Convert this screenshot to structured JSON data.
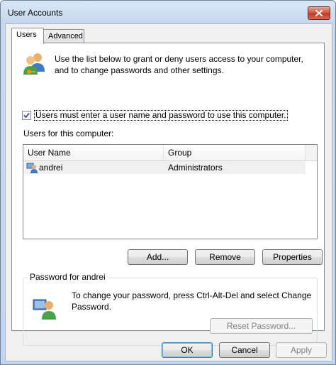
{
  "window": {
    "title": "User Accounts"
  },
  "tabs": [
    {
      "label": "Users",
      "active": true
    },
    {
      "label": "Advanced",
      "active": false
    }
  ],
  "users_tab": {
    "intro": "Use the list below to grant or deny users access to your computer, and to change passwords and other settings.",
    "require_login": {
      "checked": true,
      "label": "Users must enter a user name and password to use this computer."
    },
    "list_label": "Users for this computer:",
    "columns": [
      "User Name",
      "Group"
    ],
    "rows": [
      {
        "name": "andrei",
        "group": "Administrators"
      }
    ],
    "buttons": {
      "add": "Add...",
      "remove": "Remove",
      "properties": "Properties"
    },
    "password_group": {
      "title": "Password for andrei",
      "text": "To change your password, press Ctrl-Alt-Del and select Change Password.",
      "reset_button": "Reset Password..."
    }
  },
  "footer": {
    "ok": "OK",
    "cancel": "Cancel",
    "apply": "Apply"
  },
  "icons": {
    "intro": "users-icon",
    "row": "user-icon",
    "password": "user-password-icon",
    "close": "close-icon",
    "check": "checkmark-icon"
  }
}
